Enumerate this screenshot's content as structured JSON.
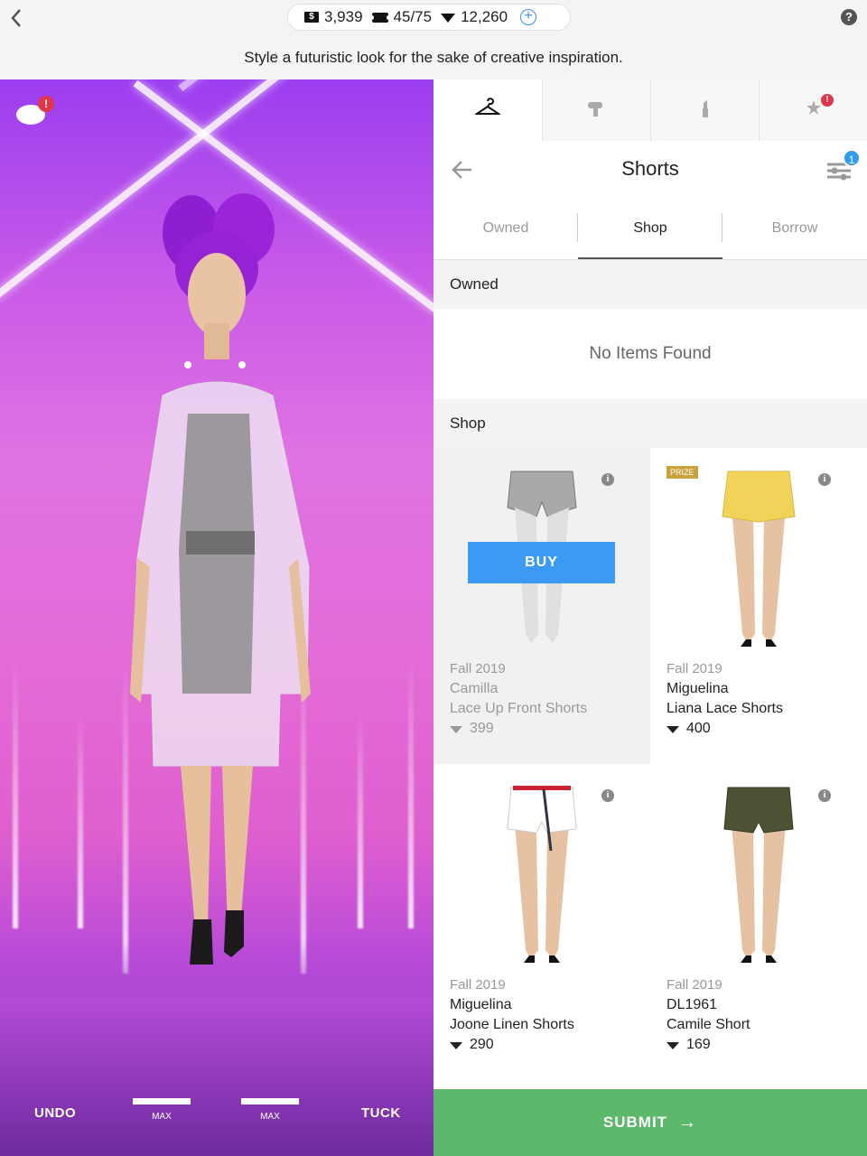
{
  "topbar": {
    "dollars": "3,939",
    "tickets": "45/75",
    "gems": "12,260"
  },
  "prompt": "Style a futuristic look for the sake of creative inspiration.",
  "stage": {
    "chat_badge": "!",
    "undo": "UNDO",
    "slider1_label": "MAX",
    "slider2_label": "MAX",
    "tuck": "TUCK"
  },
  "panel": {
    "category_tabs": [
      {
        "icon": "hanger-icon"
      },
      {
        "icon": "hair-dryer-icon"
      },
      {
        "icon": "lipstick-icon"
      },
      {
        "icon": "star-wand-icon",
        "badge": "!"
      }
    ],
    "title": "Shorts",
    "filter_badge": "1",
    "sub_tabs": [
      "Owned",
      "Shop",
      "Borrow"
    ],
    "active_sub_tab": "Shop",
    "owned_heading": "Owned",
    "owned_empty": "No Items Found",
    "shop_heading": "Shop",
    "items": [
      {
        "season": "Fall 2019",
        "brand": "Camilla",
        "name": "Lace Up Front Shorts",
        "price": "399",
        "color": "#a9a9a9",
        "selected": true,
        "buy": "BUY"
      },
      {
        "season": "Fall 2019",
        "brand": "Miguelina",
        "name": "Liana Lace Shorts",
        "price": "400",
        "color": "#f2d35a",
        "prize": "PRIZE"
      },
      {
        "season": "Fall 2019",
        "brand": "Miguelina",
        "name": "Joone Linen Shorts",
        "price": "290",
        "color": "#ffffff"
      },
      {
        "season": "Fall 2019",
        "brand": "DL1961",
        "name": "Camile Short",
        "price": "169",
        "color": "#4d5234"
      }
    ],
    "submit": "SUBMIT"
  }
}
